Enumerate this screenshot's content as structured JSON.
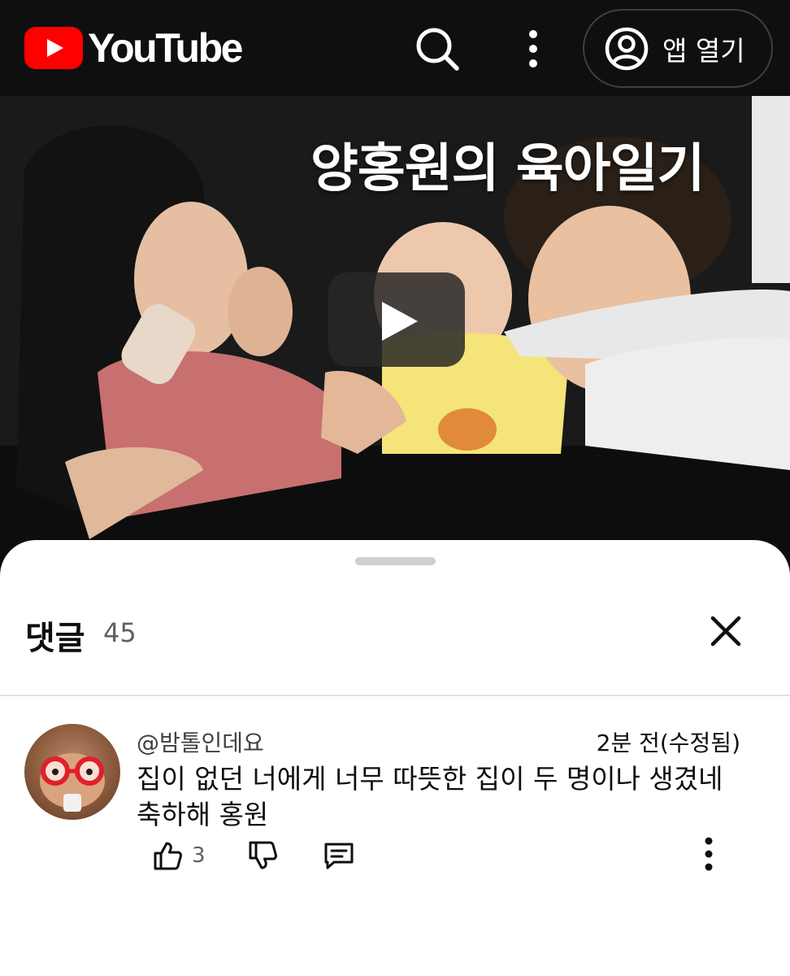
{
  "header": {
    "logo_text": "YouTube",
    "open_app_label": "앱 열기",
    "icons": [
      "youtube-logo-icon",
      "search-icon",
      "more-vert-icon",
      "account-icon"
    ]
  },
  "video": {
    "overlay_title": "양홍원의 육아일기",
    "icons": [
      "play-icon"
    ]
  },
  "comments_panel": {
    "title": "댓글",
    "count": "45",
    "icons": [
      "close-icon"
    ],
    "comments": [
      {
        "author": "@밤톨인데요",
        "time": "2분 전(수정됨)",
        "text_line1": "집이 없던 너에게 너무 따뜻한 집이 두 명이나 생겼네",
        "text_line2": "축하해 홍원",
        "likes": "3",
        "icons": [
          "thumb-up-icon",
          "thumb-down-icon",
          "reply-icon",
          "more-vert-icon"
        ]
      }
    ]
  },
  "colors": {
    "topbar_bg": "#0f0f0f",
    "brand_red": "#ff0000",
    "secondary_text": "#606060"
  }
}
